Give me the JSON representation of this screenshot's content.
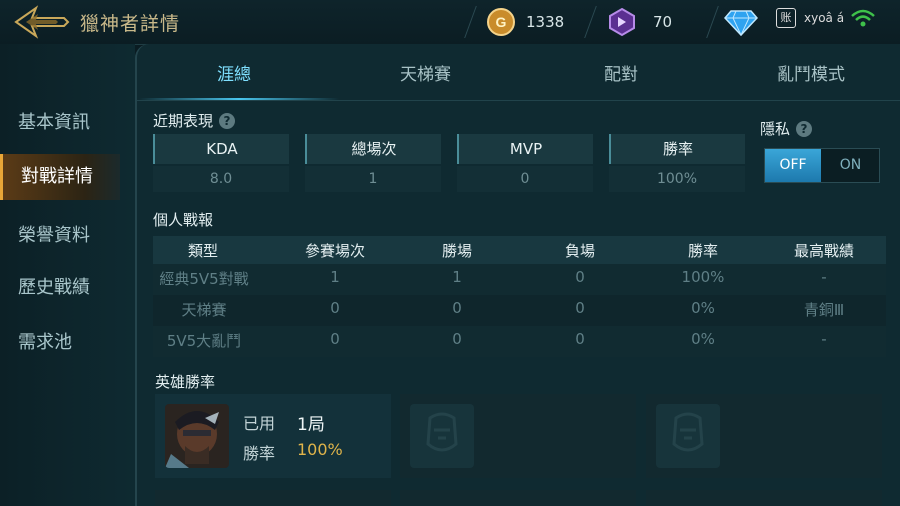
{
  "header": {
    "title": "獵神者詳情",
    "gold": "1338",
    "crystal": "70",
    "status_text": "xyoâ á"
  },
  "sidebar": {
    "items": [
      {
        "label": "基本資訊"
      },
      {
        "label": "對戰詳情"
      },
      {
        "label": "榮譽資料"
      },
      {
        "label": "歷史戰績"
      },
      {
        "label": "需求池"
      }
    ],
    "active_index": 1
  },
  "tabs": [
    "涯總",
    "天梯賽",
    "配對",
    "亂鬥模式"
  ],
  "recent": {
    "title": "近期表現",
    "help": "?",
    "stats": [
      {
        "label": "KDA",
        "value": "8.0"
      },
      {
        "label": "總場次",
        "value": "1"
      },
      {
        "label": "MVP",
        "value": "0"
      },
      {
        "label": "勝率",
        "value": "100%"
      }
    ]
  },
  "privacy": {
    "title": "隱私",
    "help": "?",
    "off_label": "OFF",
    "on_label": "ON",
    "state": "OFF"
  },
  "report": {
    "title": "個人戰報",
    "columns": [
      "類型",
      "參賽場次",
      "勝場",
      "負場",
      "勝率",
      "最高戰績"
    ],
    "rows": [
      [
        "經典5V5對戰",
        "1",
        "1",
        "0",
        "100%",
        "-"
      ],
      [
        "天梯賽",
        "0",
        "0",
        "0",
        "0%",
        "青銅Ⅲ"
      ],
      [
        "5V5大亂鬥",
        "0",
        "0",
        "0",
        "0%",
        "-"
      ]
    ]
  },
  "heroes": {
    "title": "英雄勝率",
    "cards": [
      {
        "used_label": "已用",
        "used_value": "1局",
        "rate_label": "勝率",
        "rate_value": "100%"
      }
    ]
  },
  "colors": {
    "accent_tab": "#7fe0ff",
    "active_sidebar": "#e8a637",
    "hero_rate": "#e0b44a"
  },
  "icons": [
    "back-arrow-icon",
    "gold-coin-icon",
    "crystal-icon",
    "diamond-icon",
    "help-icon",
    "hero-placeholder-icon"
  ]
}
